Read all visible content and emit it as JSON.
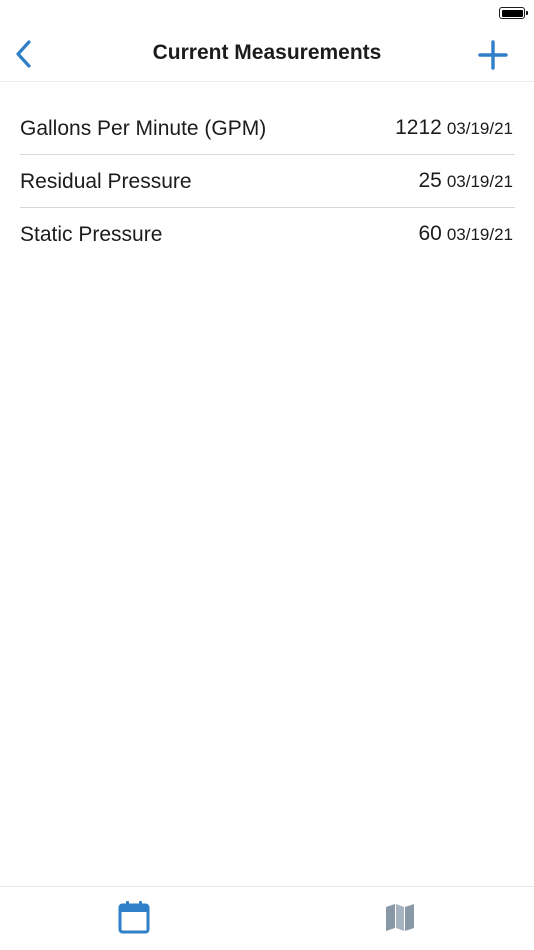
{
  "nav": {
    "title": "Current Measurements",
    "back_icon": "chevron-left-icon",
    "add_icon": "plus-icon"
  },
  "measurements": [
    {
      "label": "Gallons Per Minute (GPM)",
      "value": "1212",
      "date": "03/19/21"
    },
    {
      "label": "Residual Pressure",
      "value": "25",
      "date": "03/19/21"
    },
    {
      "label": "Static Pressure",
      "value": "60",
      "date": "03/19/21"
    }
  ],
  "tabs": [
    {
      "icon": "calendar-icon",
      "active": true
    },
    {
      "icon": "map-icon",
      "active": false
    }
  ],
  "colors": {
    "accent": "#2f7fc8",
    "inactive_icon": "#8a99a8",
    "text": "#1c1c1e",
    "separator": "#d8d8d8"
  }
}
